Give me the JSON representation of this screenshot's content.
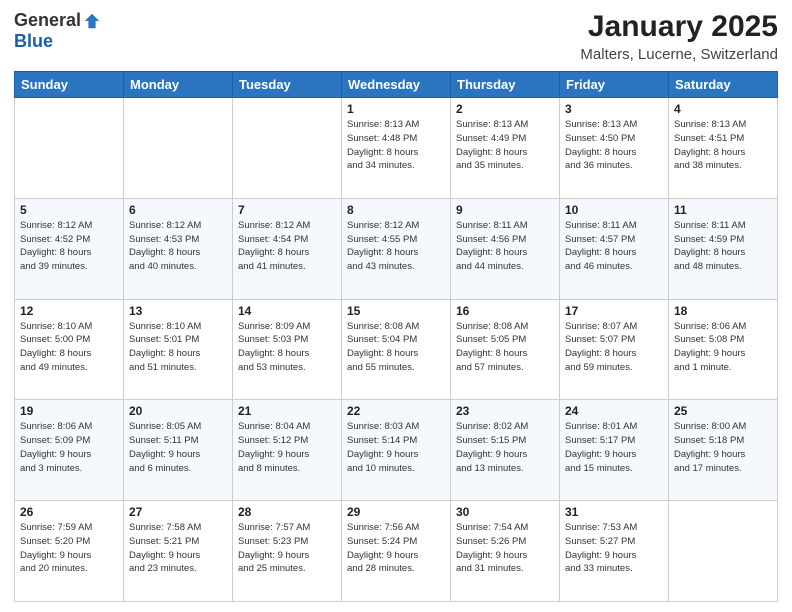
{
  "header": {
    "logo_general": "General",
    "logo_blue": "Blue",
    "title": "January 2025",
    "subtitle": "Malters, Lucerne, Switzerland"
  },
  "calendar": {
    "days_of_week": [
      "Sunday",
      "Monday",
      "Tuesday",
      "Wednesday",
      "Thursday",
      "Friday",
      "Saturday"
    ],
    "weeks": [
      [
        {
          "day": "",
          "info": ""
        },
        {
          "day": "",
          "info": ""
        },
        {
          "day": "",
          "info": ""
        },
        {
          "day": "1",
          "info": "Sunrise: 8:13 AM\nSunset: 4:48 PM\nDaylight: 8 hours\nand 34 minutes."
        },
        {
          "day": "2",
          "info": "Sunrise: 8:13 AM\nSunset: 4:49 PM\nDaylight: 8 hours\nand 35 minutes."
        },
        {
          "day": "3",
          "info": "Sunrise: 8:13 AM\nSunset: 4:50 PM\nDaylight: 8 hours\nand 36 minutes."
        },
        {
          "day": "4",
          "info": "Sunrise: 8:13 AM\nSunset: 4:51 PM\nDaylight: 8 hours\nand 38 minutes."
        }
      ],
      [
        {
          "day": "5",
          "info": "Sunrise: 8:12 AM\nSunset: 4:52 PM\nDaylight: 8 hours\nand 39 minutes."
        },
        {
          "day": "6",
          "info": "Sunrise: 8:12 AM\nSunset: 4:53 PM\nDaylight: 8 hours\nand 40 minutes."
        },
        {
          "day": "7",
          "info": "Sunrise: 8:12 AM\nSunset: 4:54 PM\nDaylight: 8 hours\nand 41 minutes."
        },
        {
          "day": "8",
          "info": "Sunrise: 8:12 AM\nSunset: 4:55 PM\nDaylight: 8 hours\nand 43 minutes."
        },
        {
          "day": "9",
          "info": "Sunrise: 8:11 AM\nSunset: 4:56 PM\nDaylight: 8 hours\nand 44 minutes."
        },
        {
          "day": "10",
          "info": "Sunrise: 8:11 AM\nSunset: 4:57 PM\nDaylight: 8 hours\nand 46 minutes."
        },
        {
          "day": "11",
          "info": "Sunrise: 8:11 AM\nSunset: 4:59 PM\nDaylight: 8 hours\nand 48 minutes."
        }
      ],
      [
        {
          "day": "12",
          "info": "Sunrise: 8:10 AM\nSunset: 5:00 PM\nDaylight: 8 hours\nand 49 minutes."
        },
        {
          "day": "13",
          "info": "Sunrise: 8:10 AM\nSunset: 5:01 PM\nDaylight: 8 hours\nand 51 minutes."
        },
        {
          "day": "14",
          "info": "Sunrise: 8:09 AM\nSunset: 5:03 PM\nDaylight: 8 hours\nand 53 minutes."
        },
        {
          "day": "15",
          "info": "Sunrise: 8:08 AM\nSunset: 5:04 PM\nDaylight: 8 hours\nand 55 minutes."
        },
        {
          "day": "16",
          "info": "Sunrise: 8:08 AM\nSunset: 5:05 PM\nDaylight: 8 hours\nand 57 minutes."
        },
        {
          "day": "17",
          "info": "Sunrise: 8:07 AM\nSunset: 5:07 PM\nDaylight: 8 hours\nand 59 minutes."
        },
        {
          "day": "18",
          "info": "Sunrise: 8:06 AM\nSunset: 5:08 PM\nDaylight: 9 hours\nand 1 minute."
        }
      ],
      [
        {
          "day": "19",
          "info": "Sunrise: 8:06 AM\nSunset: 5:09 PM\nDaylight: 9 hours\nand 3 minutes."
        },
        {
          "day": "20",
          "info": "Sunrise: 8:05 AM\nSunset: 5:11 PM\nDaylight: 9 hours\nand 6 minutes."
        },
        {
          "day": "21",
          "info": "Sunrise: 8:04 AM\nSunset: 5:12 PM\nDaylight: 9 hours\nand 8 minutes."
        },
        {
          "day": "22",
          "info": "Sunrise: 8:03 AM\nSunset: 5:14 PM\nDaylight: 9 hours\nand 10 minutes."
        },
        {
          "day": "23",
          "info": "Sunrise: 8:02 AM\nSunset: 5:15 PM\nDaylight: 9 hours\nand 13 minutes."
        },
        {
          "day": "24",
          "info": "Sunrise: 8:01 AM\nSunset: 5:17 PM\nDaylight: 9 hours\nand 15 minutes."
        },
        {
          "day": "25",
          "info": "Sunrise: 8:00 AM\nSunset: 5:18 PM\nDaylight: 9 hours\nand 17 minutes."
        }
      ],
      [
        {
          "day": "26",
          "info": "Sunrise: 7:59 AM\nSunset: 5:20 PM\nDaylight: 9 hours\nand 20 minutes."
        },
        {
          "day": "27",
          "info": "Sunrise: 7:58 AM\nSunset: 5:21 PM\nDaylight: 9 hours\nand 23 minutes."
        },
        {
          "day": "28",
          "info": "Sunrise: 7:57 AM\nSunset: 5:23 PM\nDaylight: 9 hours\nand 25 minutes."
        },
        {
          "day": "29",
          "info": "Sunrise: 7:56 AM\nSunset: 5:24 PM\nDaylight: 9 hours\nand 28 minutes."
        },
        {
          "day": "30",
          "info": "Sunrise: 7:54 AM\nSunset: 5:26 PM\nDaylight: 9 hours\nand 31 minutes."
        },
        {
          "day": "31",
          "info": "Sunrise: 7:53 AM\nSunset: 5:27 PM\nDaylight: 9 hours\nand 33 minutes."
        },
        {
          "day": "",
          "info": ""
        }
      ]
    ]
  }
}
